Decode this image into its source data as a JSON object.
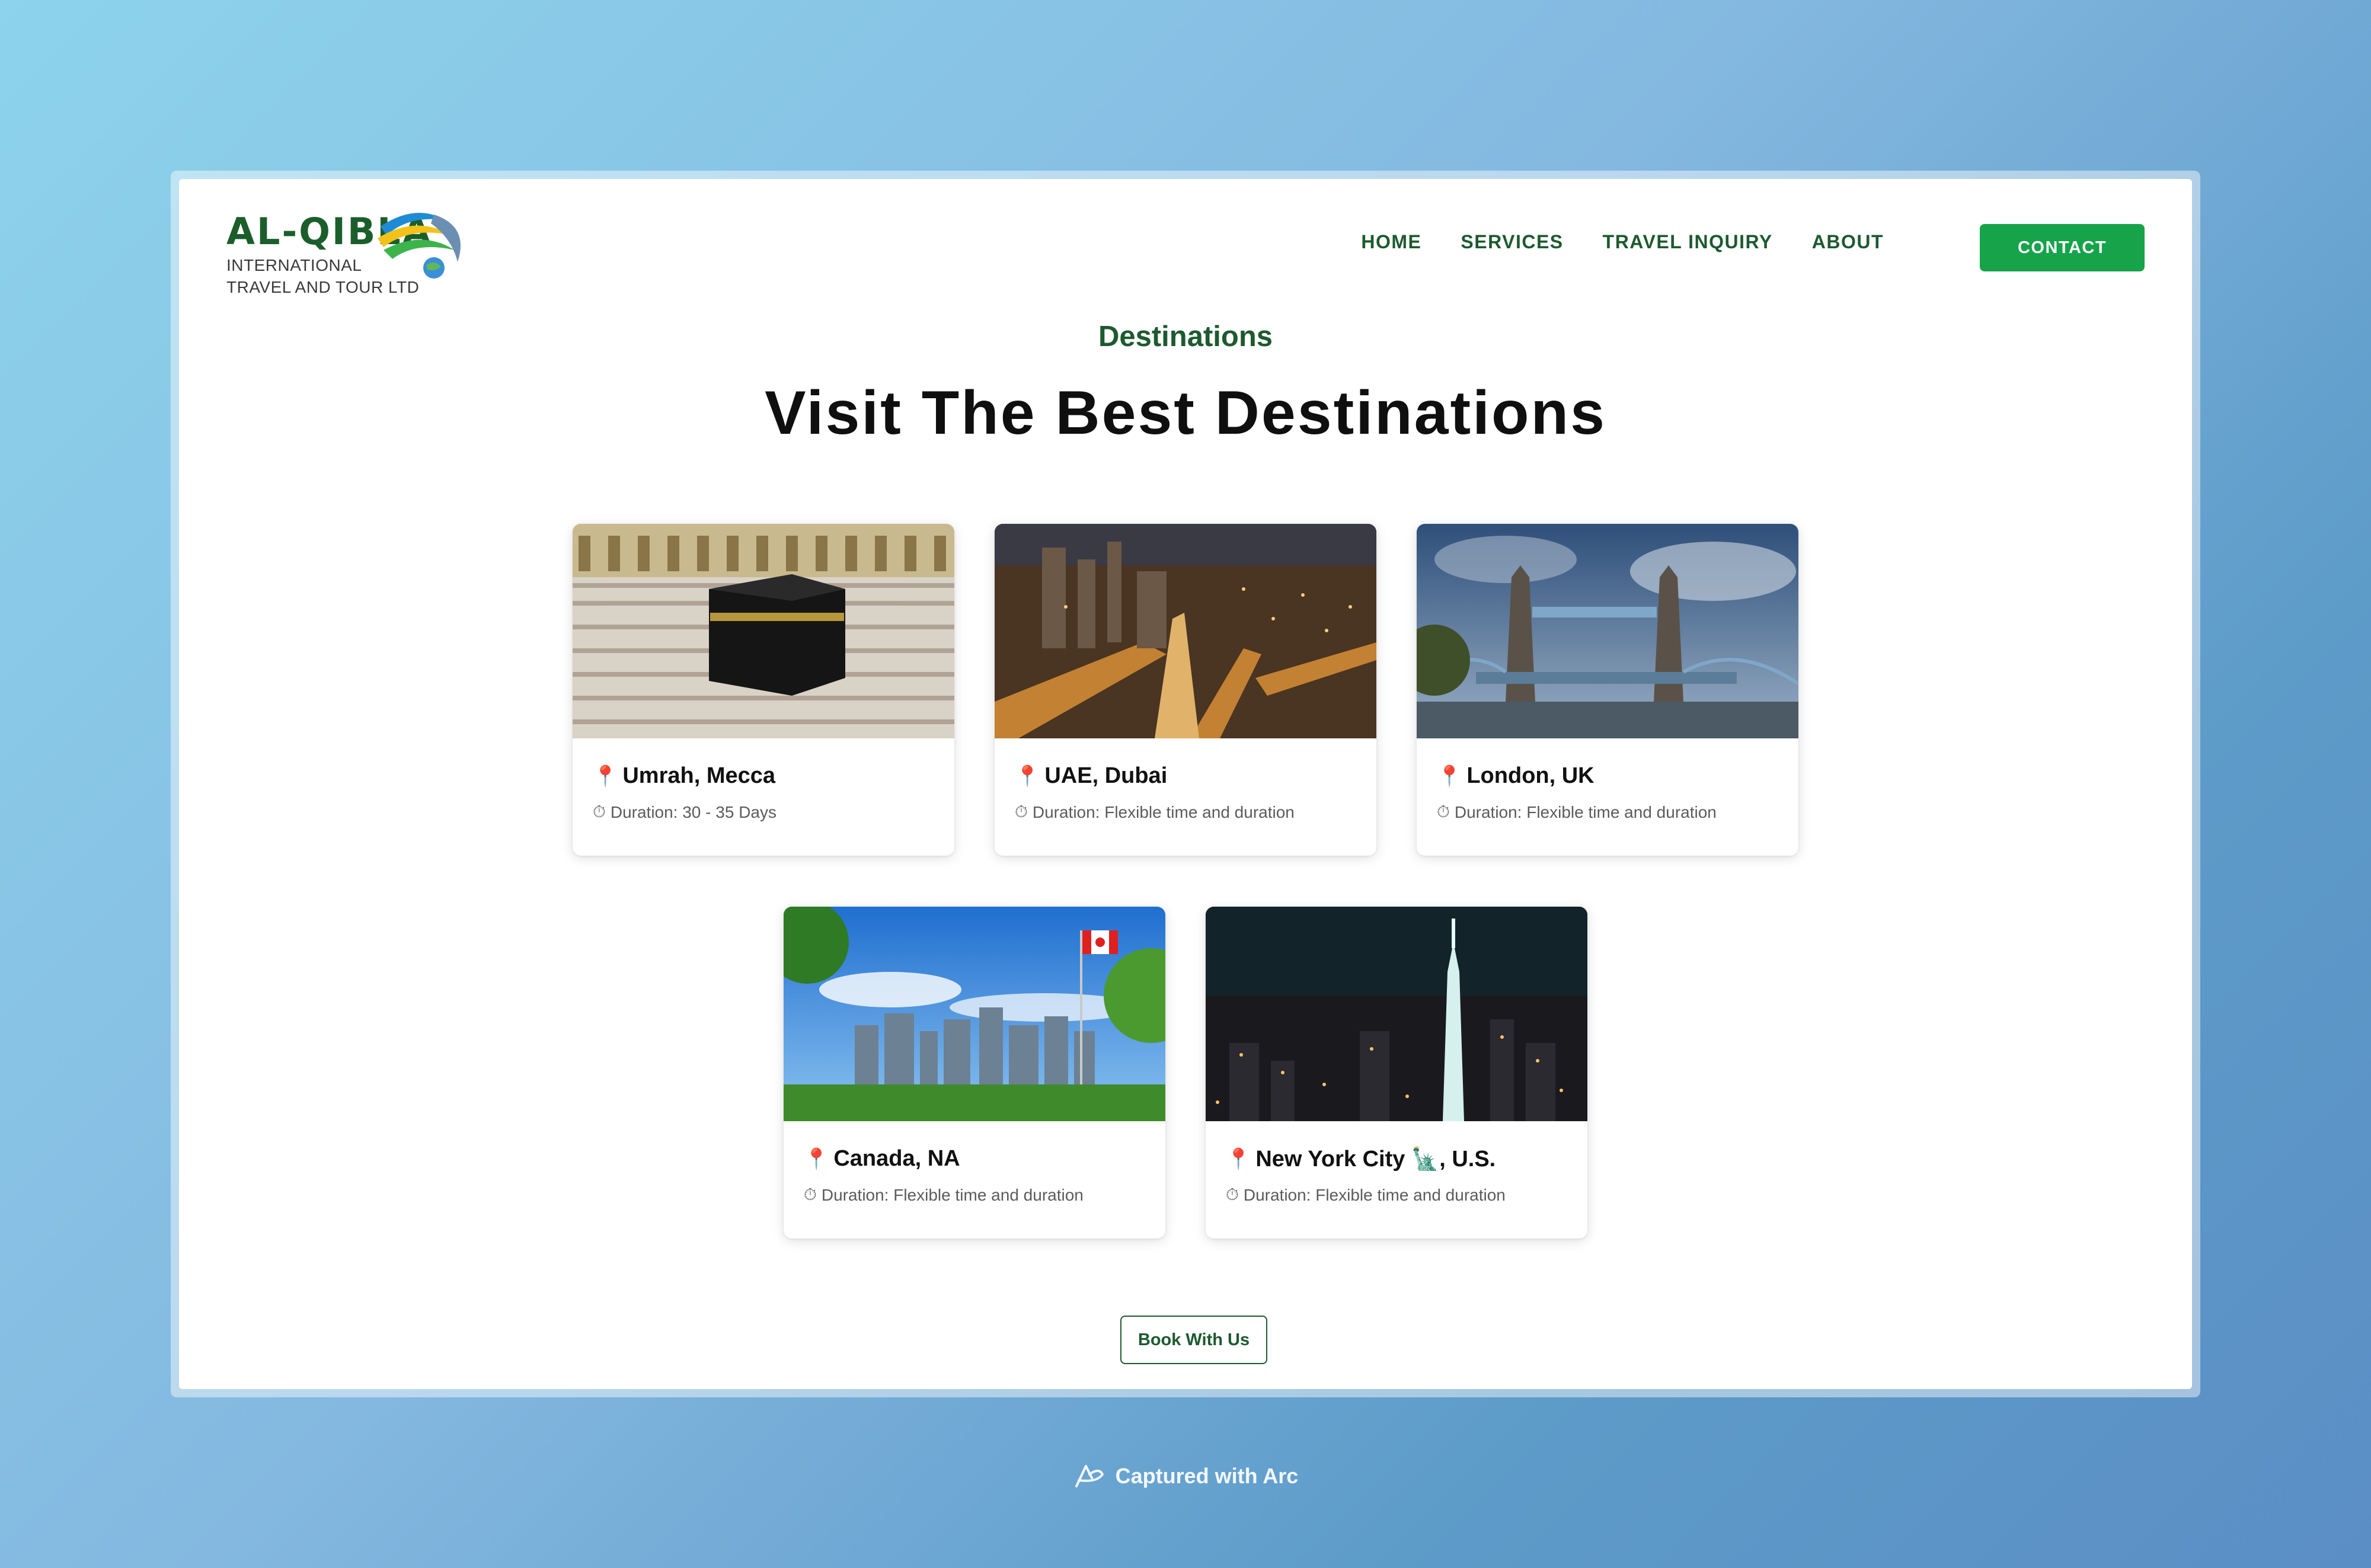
{
  "brand": {
    "name": "AL-QIBLA",
    "subtitle_line1": "INTERNATIONAL",
    "subtitle_line2": "TRAVEL AND TOUR LTD"
  },
  "nav": {
    "items": [
      {
        "label": "HOME"
      },
      {
        "label": "SERVICES"
      },
      {
        "label": "TRAVEL INQUIRY"
      },
      {
        "label": "ABOUT"
      }
    ],
    "contact_label": "CONTACT"
  },
  "section": {
    "eyebrow": "Destinations",
    "headline": "Visit The Best Destinations"
  },
  "destinations": [
    {
      "title": "Umrah, Mecca",
      "duration": "Duration: 30 - 35 Days",
      "image": "kaaba-photo"
    },
    {
      "title": "UAE, Dubai",
      "duration": "Duration: Flexible time and duration",
      "image": "dubai-night-photo"
    },
    {
      "title": "London, UK",
      "duration": "Duration: Flexible time and duration",
      "image": "tower-bridge-photo"
    },
    {
      "title": "Canada, NA",
      "duration": "Duration: Flexible time and duration",
      "image": "calgary-skyline-photo"
    },
    {
      "title": "New York City 🗽, U.S.",
      "duration": "Duration: Flexible time and duration",
      "image": "nyc-night-photo"
    }
  ],
  "icons": {
    "location": "map-pin-icon",
    "duration": "stopwatch-icon"
  },
  "book_label": "Book With Us",
  "footer": {
    "caption": "Captured with Arc"
  },
  "colors": {
    "brand_green": "#1d5a2f",
    "button_green": "#16a34a",
    "pin_red": "#d81e2a"
  }
}
